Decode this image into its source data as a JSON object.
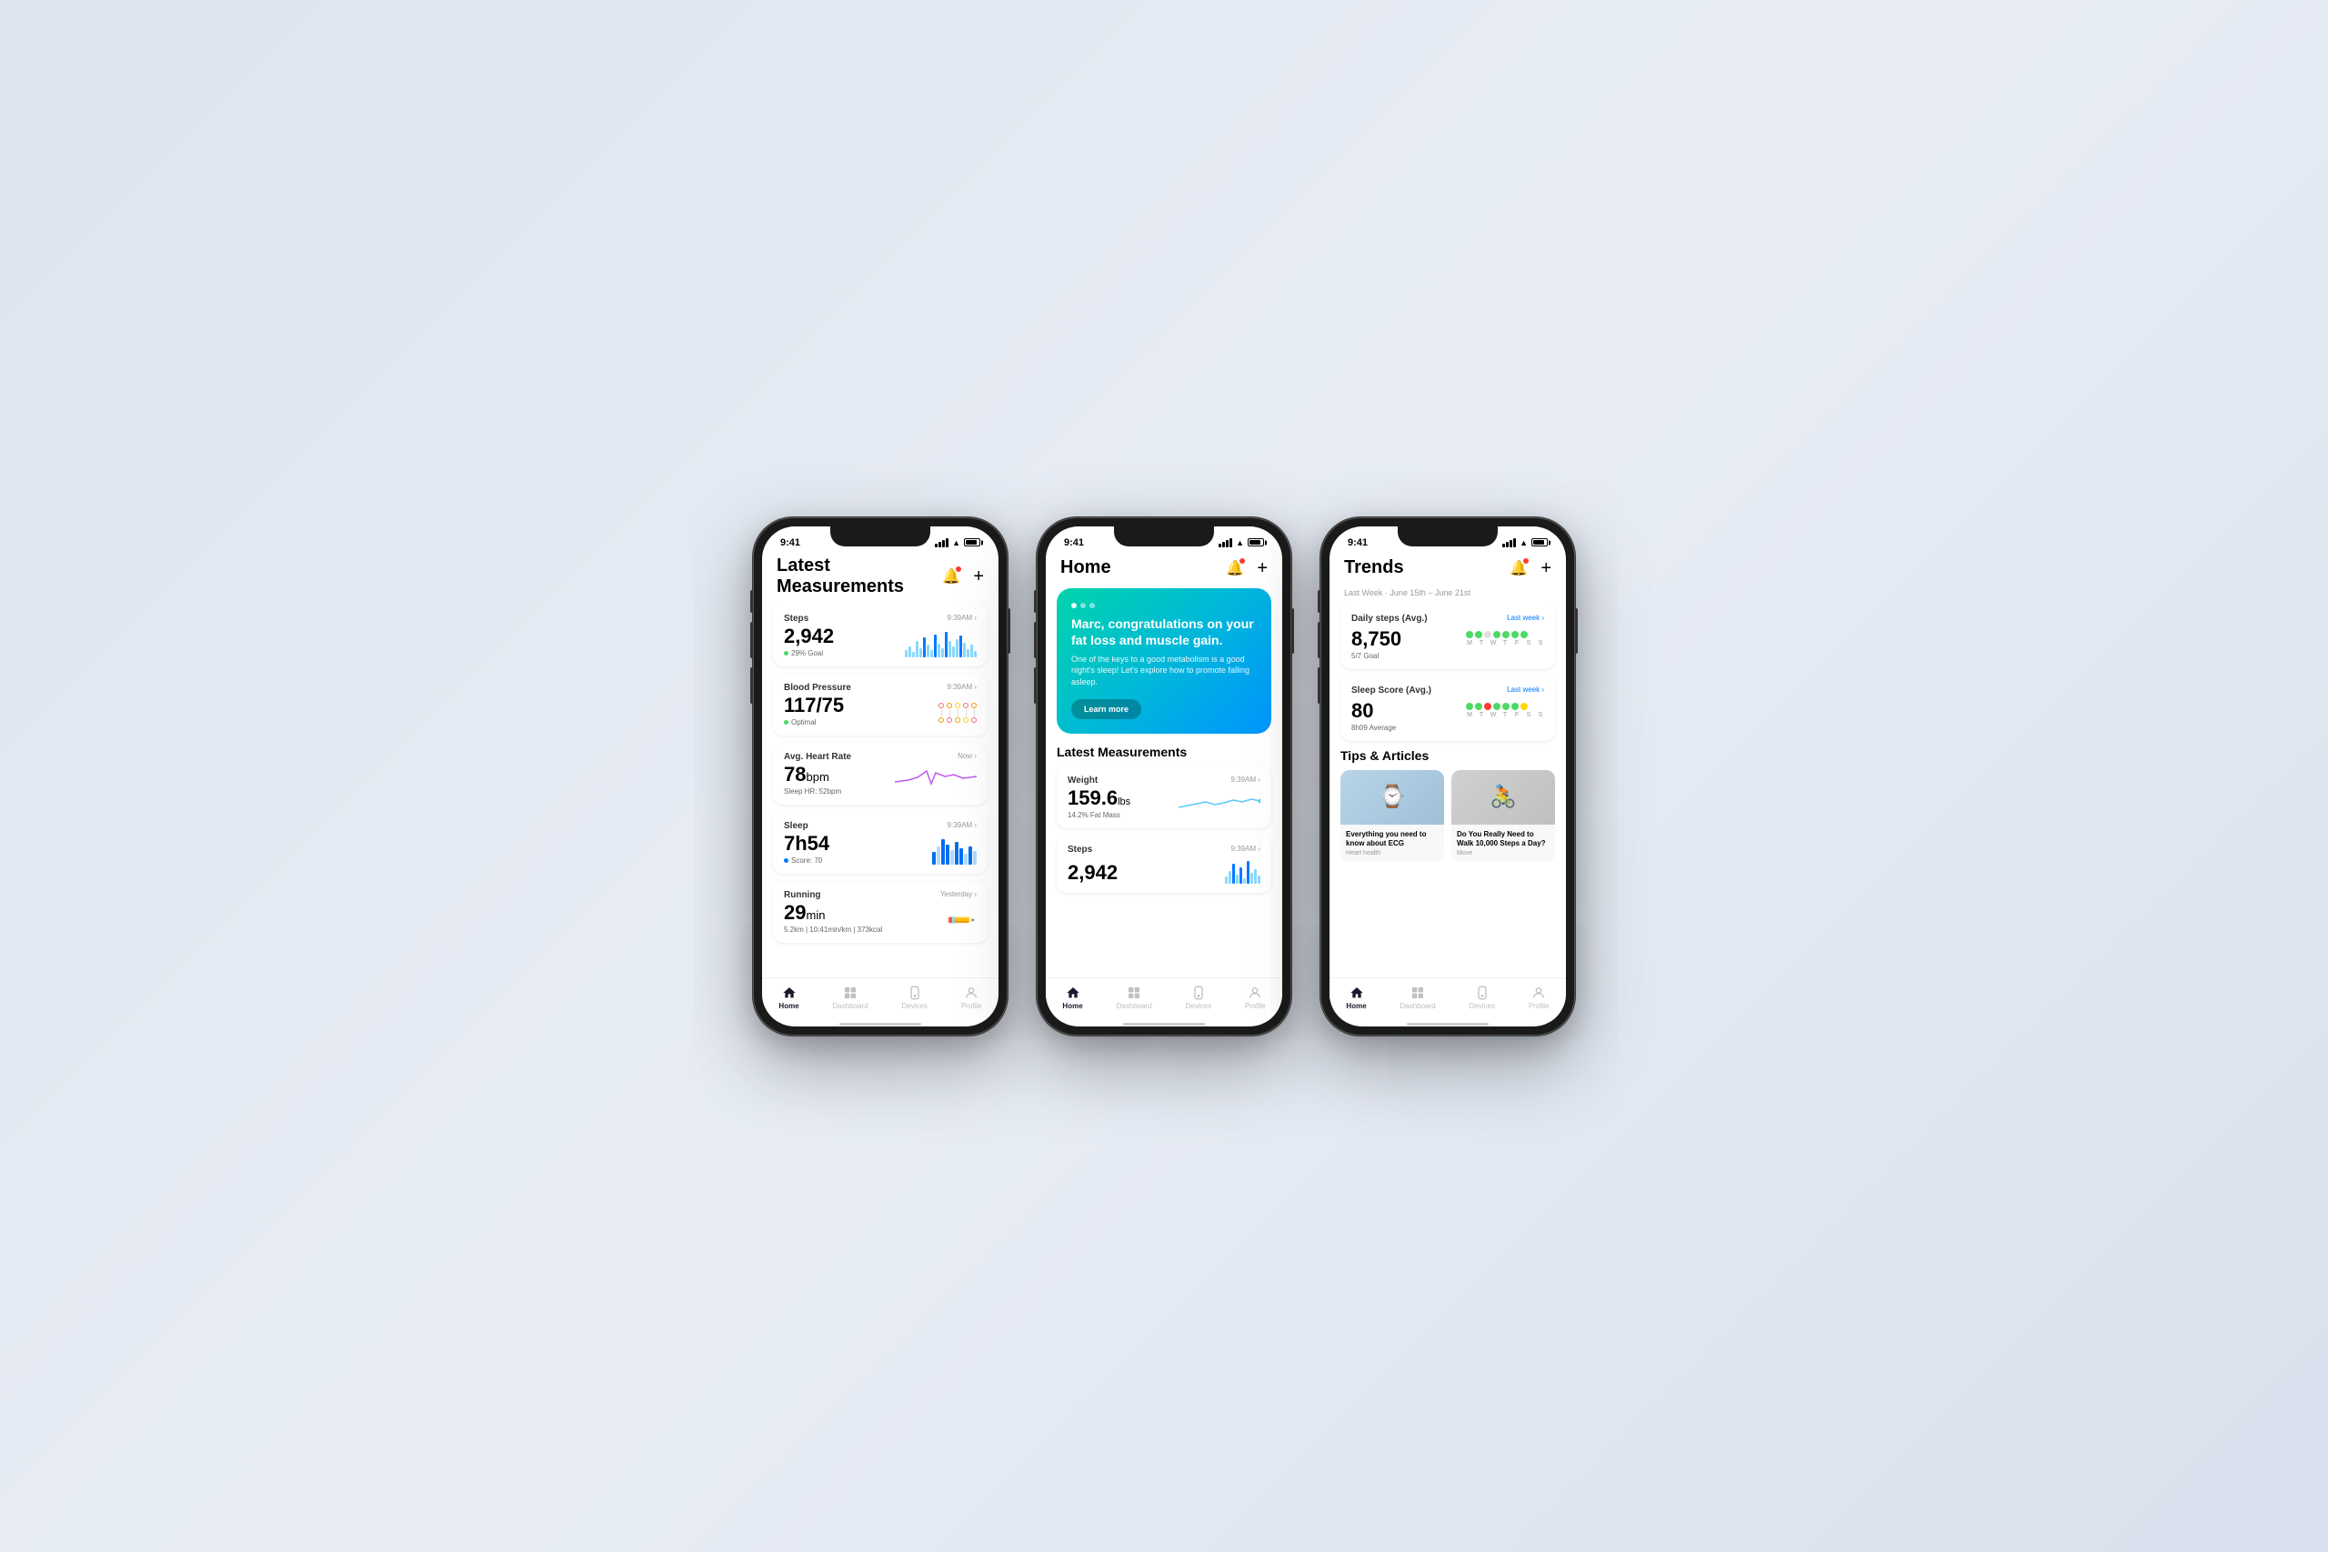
{
  "page": {
    "background": "light-blue-gradient"
  },
  "phone1": {
    "status": {
      "time": "9:41",
      "signal": "full",
      "wifi": true,
      "battery": "full"
    },
    "header": {
      "title": "Latest Measurements",
      "bell_label": "notifications",
      "plus_label": "add"
    },
    "measurements": [
      {
        "title": "Steps",
        "time": "9:39AM",
        "value": "2,942",
        "sub": "29% Goal",
        "status_color": "green"
      },
      {
        "title": "Blood Pressure",
        "time": "9:39AM",
        "value": "117/75",
        "sub": "Optimal",
        "status_color": "green"
      },
      {
        "title": "Avg. Heart Rate",
        "time": "Now",
        "value": "78",
        "unit": "bpm",
        "sub": "Sleep HR: 52bpm",
        "status_color": "none"
      },
      {
        "title": "Sleep",
        "time": "9:39AM",
        "value": "7h54",
        "sub": "Score: 70",
        "status_color": "green"
      },
      {
        "title": "Running",
        "time": "Yesterday",
        "value": "29",
        "unit": "min",
        "sub": "5.2km | 10:41min/km | 373kcal",
        "status_color": "none"
      }
    ],
    "nav": {
      "items": [
        {
          "label": "Home",
          "icon": "house",
          "active": true
        },
        {
          "label": "Dashboard",
          "icon": "chart",
          "active": false
        },
        {
          "label": "Devices",
          "icon": "watch",
          "active": false
        },
        {
          "label": "Profile",
          "icon": "person",
          "active": false
        }
      ]
    }
  },
  "phone2": {
    "status": {
      "time": "9:41"
    },
    "header": {
      "title": "Home"
    },
    "hero": {
      "title": "Marc, congratulations on your fat loss and muscle gain.",
      "subtitle": "One of the keys to a good metabolism is a good night's sleep! Let's explore how to promote falling asleep.",
      "button_label": "Learn more"
    },
    "section_title": "Latest Measurements",
    "measurements": [
      {
        "title": "Weight",
        "time": "9:39AM",
        "value": "159.6",
        "unit": "lbs",
        "sub": "14.2% Fat Mass"
      },
      {
        "title": "Steps",
        "time": "9:39AM",
        "value": "2,942",
        "sub": ""
      }
    ],
    "nav": {
      "items": [
        {
          "label": "Home",
          "icon": "house",
          "active": true
        },
        {
          "label": "Dashboard",
          "icon": "chart",
          "active": false
        },
        {
          "label": "Devices",
          "icon": "watch",
          "active": false
        },
        {
          "label": "Profile",
          "icon": "person",
          "active": false
        }
      ]
    }
  },
  "phone3": {
    "status": {
      "time": "9:41"
    },
    "header": {
      "title": "Trends"
    },
    "subtitle": "Last Week · June 15th – June 21st",
    "trends": [
      {
        "title": "Daily steps (Avg.)",
        "link": "Last week",
        "value": "8,750",
        "sub": "5/7 Goal",
        "dots": [
          "green",
          "green",
          "gray",
          "green",
          "green",
          "green",
          "green"
        ],
        "days": [
          "M",
          "T",
          "W",
          "T",
          "F",
          "S",
          "S"
        ]
      },
      {
        "title": "Sleep Score (Avg.)",
        "link": "Last week",
        "value": "80",
        "sub": "8h09 Average",
        "dots": [
          "green",
          "green",
          "red",
          "green",
          "green",
          "green",
          "yellow"
        ],
        "days": [
          "M",
          "T",
          "W",
          "T",
          "F",
          "S",
          "S"
        ]
      }
    ],
    "tips_title": "Tips & Articles",
    "tips": [
      {
        "title": "Everything you need to know about ECG",
        "category": "Heart health",
        "img_type": "watch"
      },
      {
        "title": "Do You Really Need to Walk 10,000 Steps a Day?",
        "category": "Move",
        "img_type": "bike"
      }
    ],
    "nav": {
      "items": [
        {
          "label": "Home",
          "icon": "house",
          "active": true
        },
        {
          "label": "Dashboard",
          "icon": "chart",
          "active": false
        },
        {
          "label": "Devices",
          "icon": "watch",
          "active": false
        },
        {
          "label": "Profile",
          "icon": "person",
          "active": false
        }
      ]
    }
  }
}
